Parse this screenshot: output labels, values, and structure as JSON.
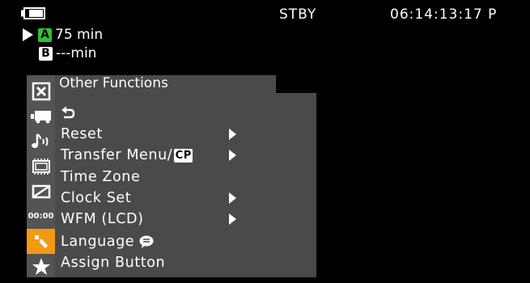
{
  "status": {
    "mode": "STBY",
    "timecode": "06:14:13:17 P"
  },
  "slots": [
    {
      "id": "A",
      "remaining": "75 min",
      "color": "#2fbf3a"
    },
    {
      "id": "B",
      "remaining": "---min",
      "color": "#ffffff"
    }
  ],
  "sidebar": {
    "items": [
      {
        "icon": "close-box-icon"
      },
      {
        "icon": "camera-icon"
      },
      {
        "icon": "audio-icon"
      },
      {
        "icon": "display-setup-icon"
      },
      {
        "icon": "recording-media-icon"
      },
      {
        "icon": "timecode-icon",
        "label": "00:00"
      },
      {
        "icon": "wrench-icon",
        "active": true
      },
      {
        "icon": "star-icon"
      }
    ]
  },
  "menu": {
    "title": "Other Functions",
    "items": [
      {
        "label": "",
        "icon": "back-arrow-icon"
      },
      {
        "label": "Reset",
        "submenu": true
      },
      {
        "label": "Transfer Menu/",
        "badge": "CP",
        "submenu": true
      },
      {
        "label": "Time Zone",
        "submenu": false
      },
      {
        "label": "Clock Set",
        "submenu": true
      },
      {
        "label": "WFM (LCD)",
        "submenu": true
      },
      {
        "label": "Language",
        "icon": "speech-bubble-icon",
        "submenu": false
      },
      {
        "label": "Assign Button",
        "submenu": false
      }
    ]
  },
  "colors": {
    "active_accent": "#f29a12",
    "panel": "#4a4a4a",
    "sidebar": "#545454",
    "slot_a": "#2fbf3a"
  }
}
